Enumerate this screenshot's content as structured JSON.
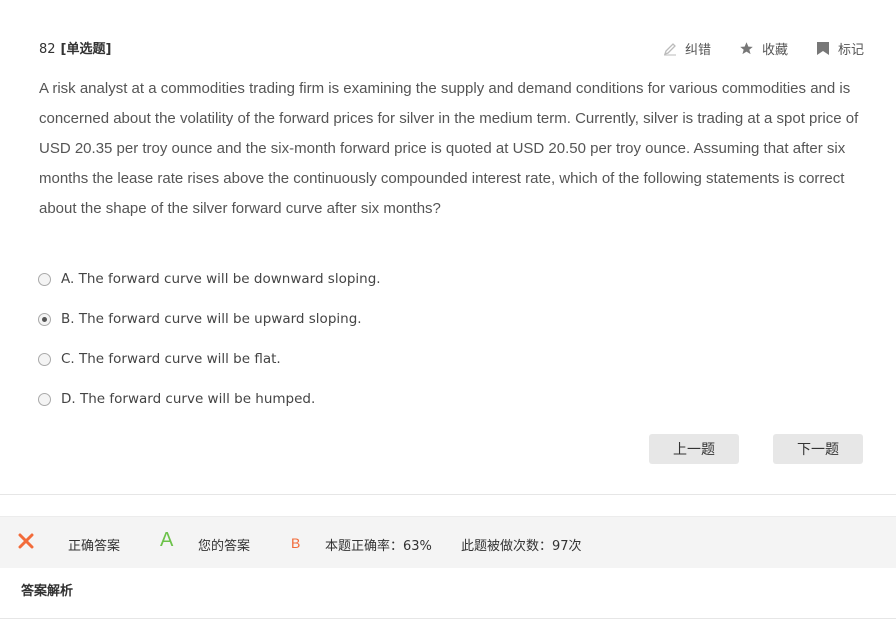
{
  "question": {
    "number": "82",
    "type": "[单选题]",
    "text": "A risk analyst at a commodities trading firm is examining the supply and demand conditions for various commodities and is concerned about the volatility of the forward prices for silver in the medium term. Currently, silver is trading at a spot price of USD 20.35 per troy ounce and the six-month forward price is quoted at USD 20.50 per troy ounce. Assuming that after six months the lease rate rises above the continuously compounded interest rate, which of the following statements is correct about the shape of the silver forward curve after six months?"
  },
  "tools": {
    "report_label": "纠错",
    "favorite_label": "收藏",
    "mark_label": "标记"
  },
  "options": [
    {
      "letter": "A",
      "text": "A. The forward curve will be downward sloping.",
      "selected": false
    },
    {
      "letter": "B",
      "text": "B. The forward curve will be upward sloping.",
      "selected": true
    },
    {
      "letter": "C",
      "text": "C. The forward curve will be flat.",
      "selected": false
    },
    {
      "letter": "D",
      "text": "D. The forward curve will be humped.",
      "selected": false
    }
  ],
  "nav": {
    "prev_label": "上一题",
    "next_label": "下一题"
  },
  "result": {
    "status_icon": "wrong-x-icon",
    "correct_label": "正确答案",
    "correct_answer": "A",
    "your_label": "您的答案",
    "your_answer": "B",
    "accuracy_text": "本题正确率：63%",
    "attempts_text": "此题被做次数：97次"
  },
  "analysis": {
    "title": "答案解析"
  },
  "colors": {
    "correct": "#6cc24a",
    "wrong": "#f26b3a",
    "button_bg": "#e7e7e7",
    "bar_bg": "#f4f4f4"
  }
}
